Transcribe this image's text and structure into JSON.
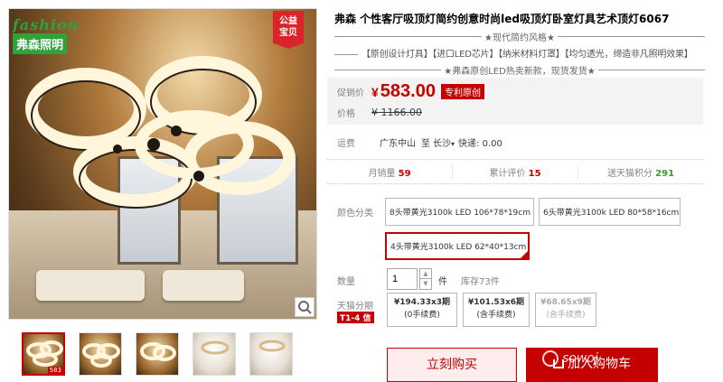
{
  "gallery": {
    "brand_en": "fashion",
    "brand_cn": "弗森照明",
    "badge_line1": "公益",
    "badge_line2": "宝贝",
    "zoom_icon": "magnifier-icon"
  },
  "thumbnails": [
    {
      "price": "583"
    },
    {
      "price": ""
    },
    {
      "price": ""
    },
    {
      "price": ""
    },
    {
      "price": ""
    }
  ],
  "product": {
    "title": "弗森 个性客厅吸顶灯简约创意时尚led吸顶灯卧室灯具艺术顶灯6067",
    "subtitle1": "★现代简约风格★",
    "tags": "【原创设计灯具】【进口LED芯片】【纳米材料灯罩】【均匀透光，缔造非凡照明效果】",
    "subtitle2": "★弗森原创LED热卖新款，现货发货★"
  },
  "price": {
    "label_promo": "促销价",
    "currency": "¥",
    "now": "583.00",
    "promo_tag": "专利原创",
    "label_orig": "价格",
    "old": "¥ 1166.00"
  },
  "shipping": {
    "label": "运费",
    "from": "广东中山",
    "to_prefix": "至",
    "to": "长沙",
    "arrow": "▾",
    "fee": "快递: 0.00"
  },
  "stats": {
    "monthly_label": "月销量",
    "monthly_value": "59",
    "reviews_label": "累计评价",
    "reviews_value": "15",
    "points_label": "送天猫积分",
    "points_value": "291"
  },
  "color": {
    "label": "颜色分类",
    "options": [
      {
        "label": "8头带黄光3100k LED 106*78*19cm",
        "selected": false
      },
      {
        "label": "6头带黄光3100k LED 80*58*16cm",
        "selected": false
      },
      {
        "label": "4头带黄光3100k LED 62*40*13cm",
        "selected": true
      }
    ]
  },
  "quantity": {
    "label": "数量",
    "value": "1",
    "up": "▲",
    "down": "▼",
    "unit": "件",
    "stock": "库存73件"
  },
  "installment": {
    "label": "天猫分期",
    "badge": "T1-4 信",
    "plans": [
      {
        "amount": "¥194.33x3期",
        "fee": "(0手续费)"
      },
      {
        "amount": "¥101.53x6期",
        "fee": "(含手续费)"
      },
      {
        "amount": "¥68.65x9期",
        "fee": "(含手续费)"
      }
    ]
  },
  "actions": {
    "buy": "立刻购买",
    "cart": "加入购物车",
    "watermark": "sowoj"
  },
  "colors": {
    "accent": "#c40000",
    "brand_green": "#2fa33a",
    "points_green": "#3a9b2b"
  }
}
